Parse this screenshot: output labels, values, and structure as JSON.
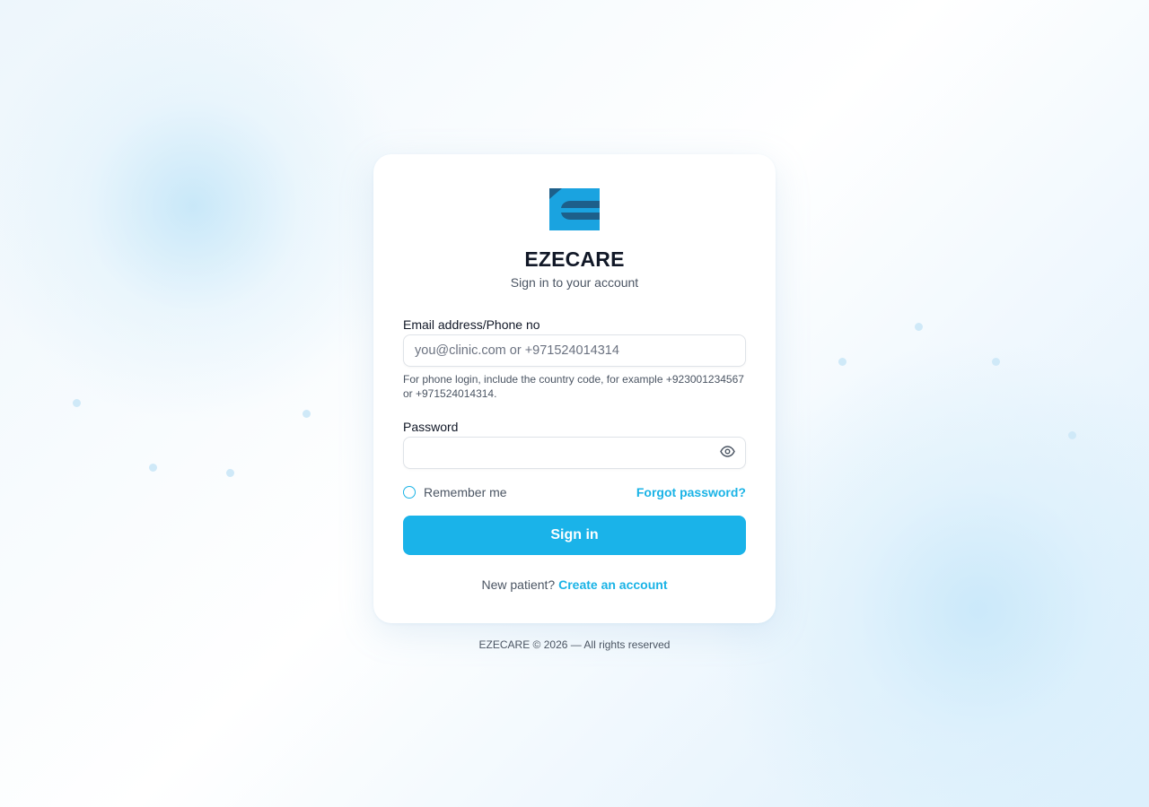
{
  "brand": {
    "name": "EZECARE",
    "subtitle": "Sign in to your account",
    "logo_icon": "ezecare-logo",
    "logo_colors": {
      "primary": "#1aa3e0",
      "dark": "#1d5f8a"
    }
  },
  "form": {
    "email": {
      "label": "Email address/Phone no",
      "placeholder": "you@clinic.com or +971524014314",
      "value": "",
      "hint": "For phone login, include the country code, for example +923001234567 or +971524014314."
    },
    "password": {
      "label": "Password",
      "value": "",
      "toggle_icon": "eye-icon"
    },
    "remember_label": "Remember me",
    "remember_checked": false,
    "forgot_label": "Forgot password?",
    "submit_label": "Sign in"
  },
  "signup": {
    "prompt": "New patient?",
    "link_label": "Create an account"
  },
  "footer": {
    "text": "EZECARE © 2026 — All rights reserved"
  },
  "colors": {
    "accent": "#1ab3e9",
    "text": "#111827",
    "muted": "#4b5563",
    "dot": "#cfe9f8"
  }
}
